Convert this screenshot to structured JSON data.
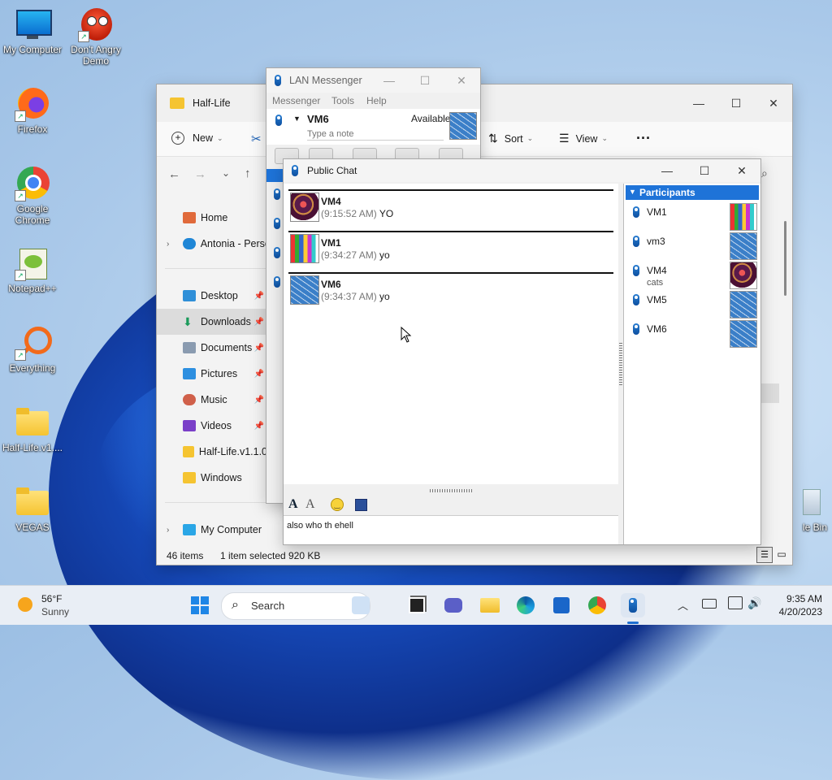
{
  "desktop": {
    "icons": [
      {
        "label": "My Computer"
      },
      {
        "label": "Don't Angry Demo"
      },
      {
        "label": "Firefox"
      },
      {
        "label": "Google Chrome"
      },
      {
        "label": "Notepad++"
      },
      {
        "label": "Everything"
      },
      {
        "label": "Half-Life.v1...."
      },
      {
        "label": "VEGAS"
      },
      {
        "label": "le Bin"
      }
    ]
  },
  "explorer": {
    "title": "Half-Life",
    "toolbar": {
      "new": "New",
      "sort": "Sort",
      "view": "View",
      "more": "···"
    },
    "nav": {
      "home": "Home",
      "antonia": "Antonia - Perso",
      "desktop": "Desktop",
      "downloads": "Downloads",
      "documents": "Documents",
      "pictures": "Pictures",
      "music": "Music",
      "videos": "Videos",
      "halflife": "Half-Life.v1.1.0",
      "windows": "Windows",
      "mycomputer": "My Computer"
    },
    "status": {
      "items": "46 items",
      "selected": "1 item selected",
      "size": "920 KB"
    }
  },
  "lan_messenger": {
    "title": "LAN Messenger",
    "menu": {
      "messenger": "Messenger",
      "tools": "Tools",
      "help": "Help"
    },
    "user": "VM6",
    "status": "Available",
    "note_placeholder": "Type a note"
  },
  "public_chat": {
    "title": "Public Chat",
    "messages": [
      {
        "name": "VM4",
        "time": "(9:15:52 AM)",
        "text": "YO"
      },
      {
        "name": "VM1",
        "time": "(9:34:27 AM)",
        "text": "yo"
      },
      {
        "name": "VM6",
        "time": "(9:34:37 AM)",
        "text": "yo"
      }
    ],
    "participants_header": "Participants",
    "participants": [
      {
        "name": "VM1",
        "note": ""
      },
      {
        "name": "vm3",
        "note": ""
      },
      {
        "name": "VM4",
        "note": "cats"
      },
      {
        "name": "VM5",
        "note": ""
      },
      {
        "name": "VM6",
        "note": ""
      }
    ],
    "input_value": "also who th ehell"
  },
  "taskbar": {
    "weather_temp": "56°F",
    "weather_desc": "Sunny",
    "search": "Search",
    "time": "9:35 AM",
    "date": "4/20/2023"
  }
}
